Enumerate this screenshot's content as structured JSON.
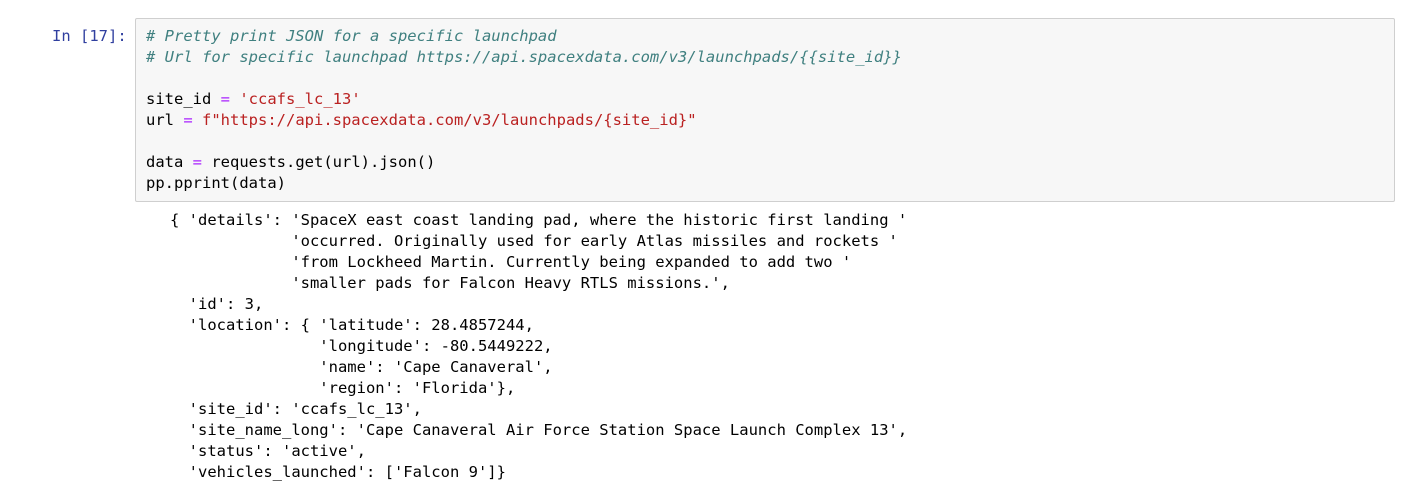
{
  "cell": {
    "prompt": "In [17]:",
    "code": {
      "line1": "# Pretty print JSON for a specific launchpad",
      "line2": "# Url for specific launchpad https://api.spacexdata.com/v3/launchpads/{{site_id}}",
      "line4_var": "site_id ",
      "line4_op": "=",
      "line4_val": " 'ccafs_lc_13'",
      "line5_var": "url ",
      "line5_op": "=",
      "line5_val": " f\"https://api.spacexdata.com/v3/launchpads/{site_id}\"",
      "line7_var": "data ",
      "line7_op": "=",
      "line7_rest": " requests.get(url).json()",
      "line8": "pp.pprint(data)"
    },
    "output_lines": [
      "{ 'details': 'SpaceX east coast landing pad, where the historic first landing '",
      "             'occurred. Originally used for early Atlas missiles and rockets '",
      "             'from Lockheed Martin. Currently being expanded to add two '",
      "             'smaller pads for Falcon Heavy RTLS missions.',",
      "  'id': 3,",
      "  'location': { 'latitude': 28.4857244,",
      "                'longitude': -80.5449222,",
      "                'name': 'Cape Canaveral',",
      "                'region': 'Florida'},",
      "  'site_id': 'ccafs_lc_13',",
      "  'site_name_long': 'Cape Canaveral Air Force Station Space Launch Complex 13',",
      "  'status': 'active',",
      "  'vehicles_launched': ['Falcon 9']}"
    ]
  }
}
